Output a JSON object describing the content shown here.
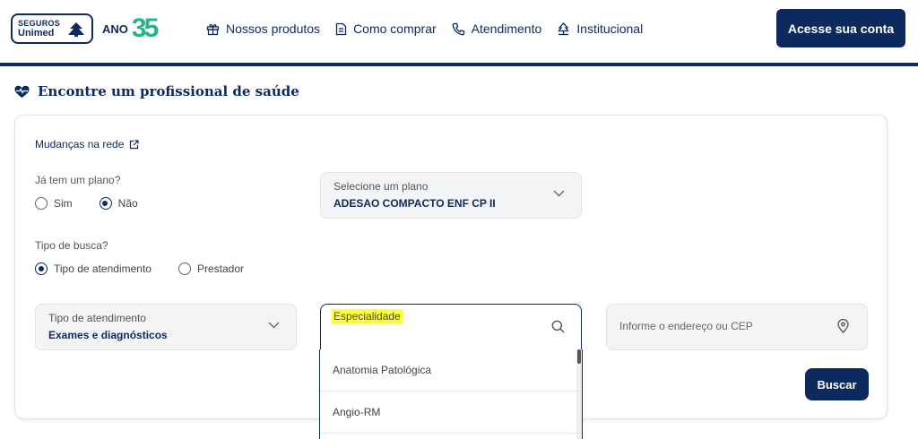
{
  "header": {
    "logo": {
      "line1": "SEGUROS",
      "line2": "Unimed",
      "ano": "ANO",
      "number": "35"
    },
    "nav": [
      {
        "label": "Nossos produtos",
        "icon": "gift-icon"
      },
      {
        "label": "Como comprar",
        "icon": "document-icon"
      },
      {
        "label": "Atendimento",
        "icon": "phone-icon"
      },
      {
        "label": "Institucional",
        "icon": "building-icon"
      }
    ],
    "account_button": "Acesse sua conta"
  },
  "section": {
    "title": "Encontre um profissional de saúde",
    "icon": "heart-pulse-icon"
  },
  "form": {
    "changes_link": "Mudanças na rede",
    "has_plan": {
      "question": "Já tem um plano?",
      "options": [
        "Sim",
        "Não"
      ],
      "selected": "Não"
    },
    "plan_select": {
      "label": "Selecione um plano",
      "value": "ADESAO COMPACTO ENF CP II"
    },
    "search_type": {
      "question": "Tipo de busca?",
      "options": [
        "Tipo de atendimento",
        "Prestador"
      ],
      "selected": "Tipo de atendimento"
    },
    "service_type": {
      "label": "Tipo de atendimento",
      "value": "Exames e diagnósticos"
    },
    "specialty": {
      "label": "Especialidade",
      "value": ""
    },
    "address": {
      "placeholder": "Informe o endereço ou CEP"
    },
    "search_button": "Buscar",
    "specialty_options": [
      "Anatomia Patológica",
      "Angio-RM"
    ]
  },
  "colors": {
    "brand": "#0c2a5e",
    "accent": "#29b38a",
    "highlight": "#ffff3a"
  }
}
